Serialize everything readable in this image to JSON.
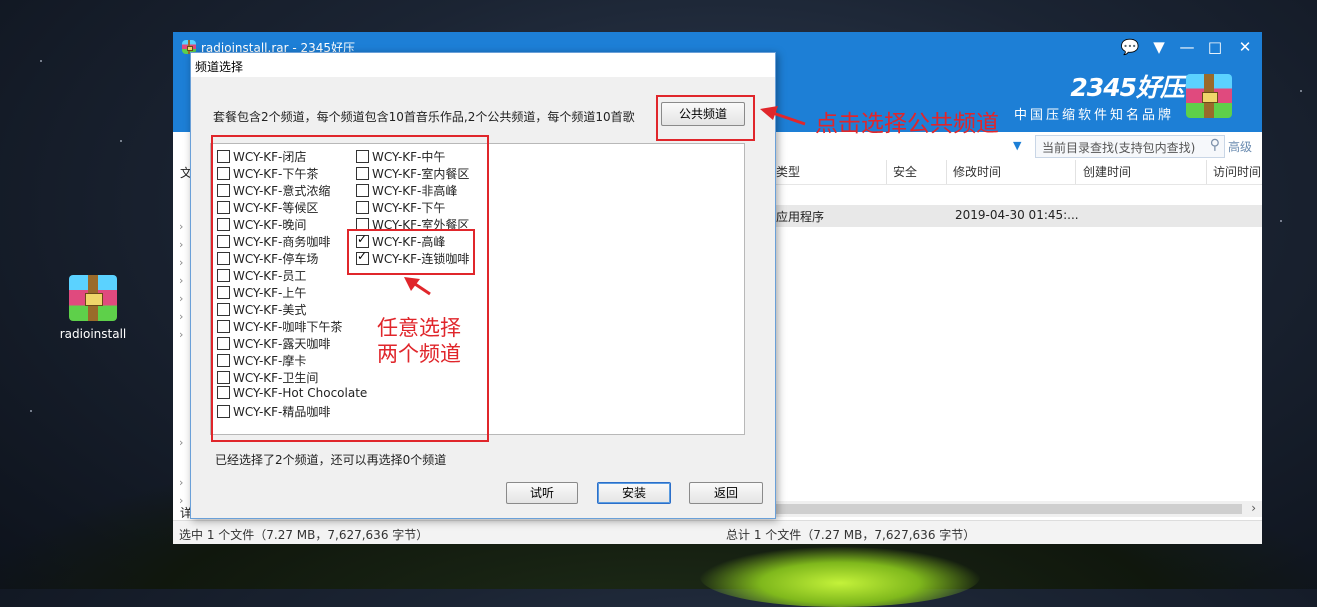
{
  "desktop": {
    "icon_label": "radioinstall"
  },
  "app": {
    "title": "radioinstall.rar - 2345好压",
    "brand": "2345好压",
    "slogan": "中国压缩软件知名品牌",
    "search_placeholder": "当前目录查找(支持包内查找)",
    "advanced_label": "高级",
    "left_col_char": "文",
    "left_col_char2": "详",
    "columns": [
      "类型",
      "安全",
      "修改时间",
      "创建时间",
      "访问时间"
    ],
    "row": {
      "type": "应用程序",
      "modified": "2019-04-30 01:45:..."
    },
    "status_left": "选中 1 个文件（7.27 MB，7,627,636 字节）",
    "status_right": "总计 1 个文件（7.27 MB，7,627,636 字节）"
  },
  "dialog": {
    "title": "频道选择",
    "description": "套餐包含2个频道，每个频道包含10首音乐作品,2个公共频道，每个频道10首歌",
    "public_button": "公共频道",
    "channels_col1": [
      {
        "label": "WCY-KF-闭店",
        "checked": false
      },
      {
        "label": "WCY-KF-下午茶",
        "checked": false
      },
      {
        "label": "WCY-KF-意式浓缩",
        "checked": false
      },
      {
        "label": "WCY-KF-等候区",
        "checked": false
      },
      {
        "label": "WCY-KF-晚间",
        "checked": false
      },
      {
        "label": "WCY-KF-商务咖啡",
        "checked": false
      },
      {
        "label": "WCY-KF-停车场",
        "checked": false
      },
      {
        "label": "WCY-KF-员工",
        "checked": false
      },
      {
        "label": "WCY-KF-上午",
        "checked": false
      },
      {
        "label": "WCY-KF-美式",
        "checked": false
      },
      {
        "label": "WCY-KF-咖啡下午茶",
        "checked": false
      },
      {
        "label": "WCY-KF-露天咖啡",
        "checked": false
      },
      {
        "label": "WCY-KF-摩卡",
        "checked": false
      },
      {
        "label": "WCY-KF-卫生间",
        "checked": false
      },
      {
        "label": "WCY-KF-Hot Chocolate",
        "checked": false
      },
      {
        "label": "WCY-KF-精品咖啡",
        "checked": false
      }
    ],
    "channels_col2": [
      {
        "label": "WCY-KF-中午",
        "checked": false
      },
      {
        "label": "WCY-KF-室内餐区",
        "checked": false
      },
      {
        "label": "WCY-KF-非高峰",
        "checked": false
      },
      {
        "label": "WCY-KF-下午",
        "checked": false
      },
      {
        "label": "WCY-KF-室外餐区",
        "checked": false
      },
      {
        "label": "WCY-KF-高峰",
        "checked": true
      },
      {
        "label": "WCY-KF-连锁咖啡",
        "checked": true
      }
    ],
    "selection_info": "已经选择了2个频道，还可以再选择0个频道",
    "buttons": {
      "listen": "试听",
      "install": "安装",
      "back": "返回"
    }
  },
  "annotations": {
    "public_hint": "点击选择公共频道",
    "choose_line1": "任意选择",
    "choose_line2": "两个频道"
  },
  "colors": {
    "accent": "#1d7fd6",
    "annotation": "#e0262b"
  }
}
